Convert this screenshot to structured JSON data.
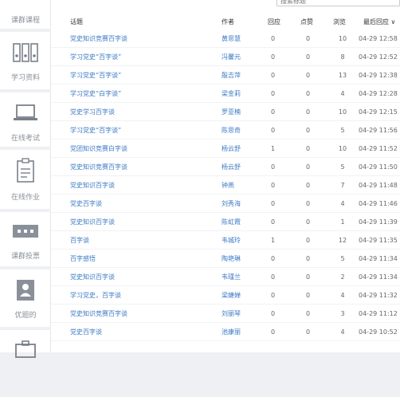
{
  "sidebar": {
    "items": [
      {
        "label": "课群课程",
        "icon": "course-icon"
      },
      {
        "label": "学习资料",
        "icon": "binders-icon"
      },
      {
        "label": "在线考试",
        "icon": "laptop-icon"
      },
      {
        "label": "在线作业",
        "icon": "clipboard-icon"
      },
      {
        "label": "课群投票",
        "icon": "ballot-icon"
      },
      {
        "label": "优题的",
        "icon": "user-doc-icon"
      },
      {
        "label": "",
        "icon": "briefcase-icon"
      }
    ]
  },
  "search": {
    "placeholder": "搜索标题"
  },
  "table": {
    "headers": {
      "title": "话题",
      "author": "作者",
      "reply": "回应",
      "like": "点赞",
      "view": "浏览",
      "time": "最后回应 ∨"
    },
    "rows": [
      {
        "title": "党史知识竞赛百字谈",
        "author": "黄思慧",
        "reply": "0",
        "like": "0",
        "view": "10",
        "time": "04-29 12:58"
      },
      {
        "title": "学习党史“百字谈”",
        "author": "冯馨元",
        "reply": "0",
        "like": "0",
        "view": "8",
        "time": "04-29 12:52"
      },
      {
        "title": "学习党史“百字谈”",
        "author": "殷吉萍",
        "reply": "0",
        "like": "0",
        "view": "13",
        "time": "04-29 12:38"
      },
      {
        "title": "学习党史“白字谈”",
        "author": "梁金莉",
        "reply": "0",
        "like": "0",
        "view": "4",
        "time": "04-29 12:28"
      },
      {
        "title": "党史学习百字谈",
        "author": "罗亚楠",
        "reply": "0",
        "like": "0",
        "view": "10",
        "time": "04-29 12:15"
      },
      {
        "title": "学习党史“百字谈”",
        "author": "陈思奇",
        "reply": "0",
        "like": "0",
        "view": "5",
        "time": "04-29 11:56"
      },
      {
        "title": "党团知识竞赛白字谈",
        "author": "杨云舒",
        "reply": "1",
        "like": "0",
        "view": "10",
        "time": "04-29 11:52"
      },
      {
        "title": "党史知识竞赛百字谈",
        "author": "杨云舒",
        "reply": "0",
        "like": "0",
        "view": "5",
        "time": "04-29 11:50"
      },
      {
        "title": "党史知识百字谈",
        "author": "钟燕",
        "reply": "0",
        "like": "0",
        "view": "7",
        "time": "04-29 11:48"
      },
      {
        "title": "党史百字谈",
        "author": "刘秀海",
        "reply": "0",
        "like": "0",
        "view": "4",
        "time": "04-29 11:46"
      },
      {
        "title": "党史知识百字谈",
        "author": "陈虹霞",
        "reply": "0",
        "like": "0",
        "view": "1",
        "time": "04-29 11:39"
      },
      {
        "title": "百字谈",
        "author": "韦城玲",
        "reply": "1",
        "like": "0",
        "view": "12",
        "time": "04-29 11:35"
      },
      {
        "title": "百字感悟",
        "author": "陶艳琳",
        "reply": "0",
        "like": "0",
        "view": "5",
        "time": "04-29 11:34"
      },
      {
        "title": "党史知识百字谈",
        "author": "韦瑾兰",
        "reply": "0",
        "like": "0",
        "view": "2",
        "time": "04-29 11:34"
      },
      {
        "title": "学习党史，百字谈",
        "author": "梁婕婵",
        "reply": "0",
        "like": "0",
        "view": "4",
        "time": "04-29 11:32"
      },
      {
        "title": "党史知识竞赛百字谈",
        "author": "刘丽琴",
        "reply": "0",
        "like": "0",
        "view": "3",
        "time": "04-29 11:12"
      },
      {
        "title": "党史百字谈",
        "author": "池康丽",
        "reply": "0",
        "like": "0",
        "view": "4",
        "time": "04-29 10:52"
      }
    ]
  }
}
